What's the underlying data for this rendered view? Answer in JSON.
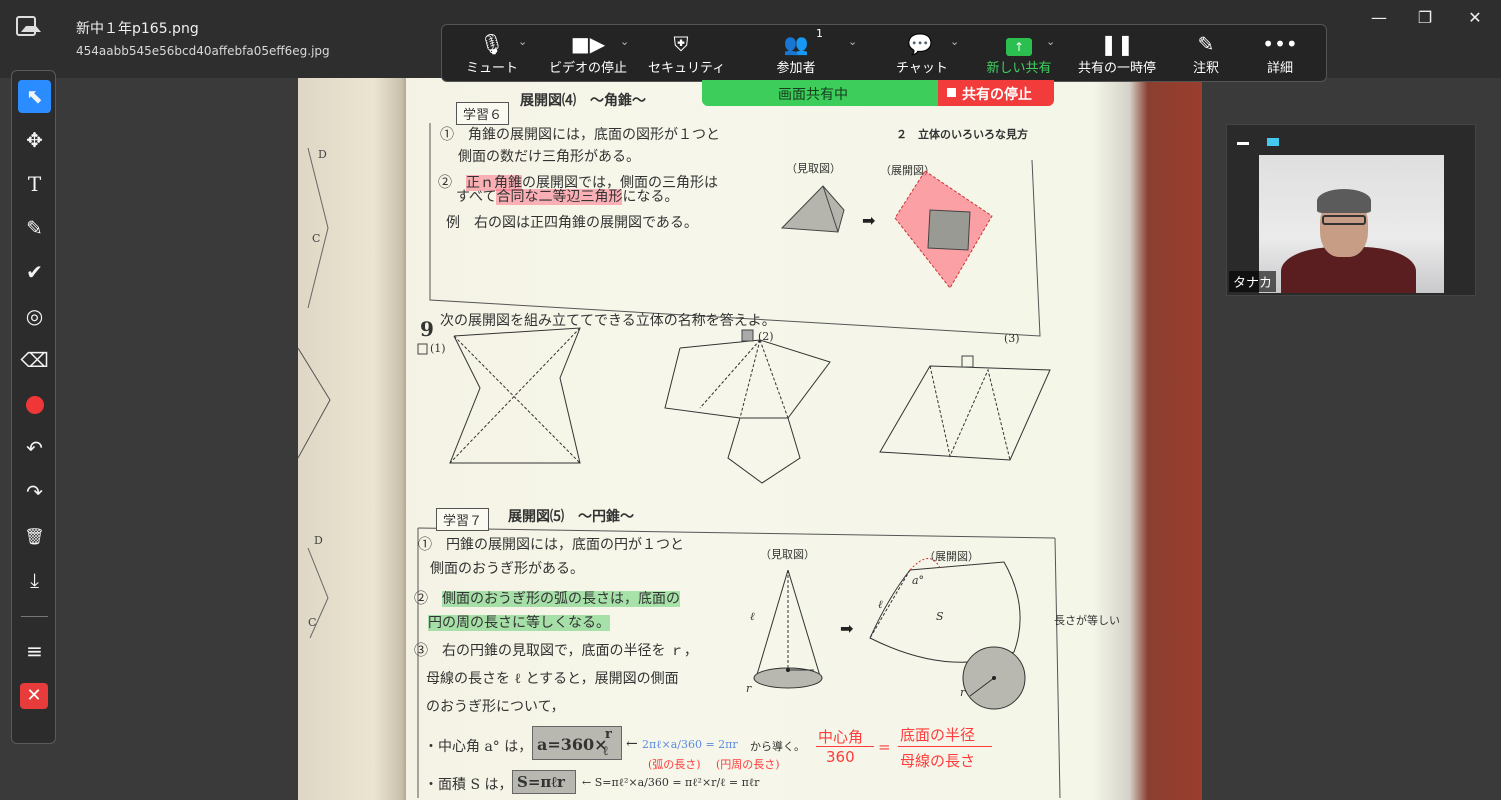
{
  "window": {
    "title": "新中１年p165.png",
    "subtitle": "454aabb545e56bcd40affebfa05eff6eg.jpg",
    "controls": {
      "minimize": "—",
      "maximize": "❐",
      "close": "✕"
    }
  },
  "zoom_toolbar": {
    "mute": "ミュート",
    "stop_video": "ビデオの停止",
    "security": "セキュリティ",
    "participants": "参加者",
    "participants_count": "1",
    "chat": "チャット",
    "new_share": "新しい共有",
    "pause_share": "共有の一時停",
    "annotate": "注釈",
    "more": "詳細"
  },
  "share_bar": {
    "status": "画面共有中",
    "stop": "共有の停止"
  },
  "annotation_tools": [
    {
      "name": "select-tool",
      "glyph": "⬉"
    },
    {
      "name": "move-tool",
      "glyph": "✥"
    },
    {
      "name": "text-tool",
      "glyph": "T"
    },
    {
      "name": "draw-tool",
      "glyph": "✎"
    },
    {
      "name": "stamp-tool",
      "glyph": "✔"
    },
    {
      "name": "spotlight-tool",
      "glyph": "◎"
    },
    {
      "name": "eraser-tool",
      "glyph": "⌫"
    },
    {
      "name": "color-tool",
      "glyph": ""
    },
    {
      "name": "undo-tool",
      "glyph": "↶"
    },
    {
      "name": "redo-tool",
      "glyph": "↷"
    },
    {
      "name": "clear-tool",
      "glyph": "🗑"
    },
    {
      "name": "save-tool",
      "glyph": "⤓"
    },
    {
      "name": "menu-tool",
      "glyph": "≡"
    },
    {
      "name": "close-tool",
      "glyph": "✕"
    }
  ],
  "page": {
    "section6_label": "学習６",
    "section6_title": "展開図⑷　〜角錐〜",
    "chapter": "２　立体のいろいろな見方",
    "s6_line1": "①　角錐の展開図には，底面の図形が１つと",
    "s6_line2": "側面の数だけ三角形がある。",
    "s6_line3a": "②　",
    "s6_line3b": "正ｎ角錐",
    "s6_line3c": "の展開図では，側面の三角形は",
    "s6_line4a": "すべて",
    "s6_line4b": "合同な二等辺三角形",
    "s6_line4c": "になる。",
    "s6_line5": "例　右の図は正四角錐の展開図である。",
    "mitori": "（見取図）",
    "tenkai": "（展開図）",
    "q9_num": "9",
    "q9_text": "次の展開図を組み立ててできる立体の名称を答えよ。",
    "q9_sub1": "(1)",
    "q9_sub2": "(2)",
    "q9_sub3": "(3)",
    "section7_label": "学習７",
    "section7_title": "展開図⑸　〜円錐〜",
    "s7_line1": "①　円錐の展開図には，底面の円が１つと",
    "s7_line2": "側面のおうぎ形がある。",
    "s7_line3a": "②　",
    "s7_line3b": "側面のおうぎ形の弧の長さは，底面の",
    "s7_line4": "円の周の長さに等しくなる。",
    "s7_line5": "③　右の円錐の見取図で，底面の半径を ｒ，",
    "s7_line6": "母線の長さを ℓ とすると，展開図の側面",
    "s7_line7": "のおうぎ形について，",
    "formula1_prefix": "・中心角 a° は，",
    "formula1_box": "a=360×",
    "formula1_frac_num": "r",
    "formula1_frac_den": "ℓ",
    "formula1_rest": "←",
    "formula1_blue": "2πℓ×a/360 = 2πr",
    "formula1_tail": "から導く。",
    "formula2_prefix": "・面積 S は，",
    "formula2_box": "S=πℓr",
    "formula2_rest": "← S=πℓ²×a/360 = πℓ²×r/ℓ = πℓr",
    "note_arc": "(弧の長さ)",
    "note_circ": "(円周の長さ)",
    "red_left_num": "中心角",
    "red_left_den": "360",
    "red_eq": "=",
    "red_right_num": "底面の半径",
    "red_right_den": "母線の長さ",
    "nagasa": "長さが等しい",
    "label_S": "S",
    "label_a": "a°",
    "label_l": "ℓ",
    "label_r": "r"
  },
  "video": {
    "name": "タナカ"
  }
}
